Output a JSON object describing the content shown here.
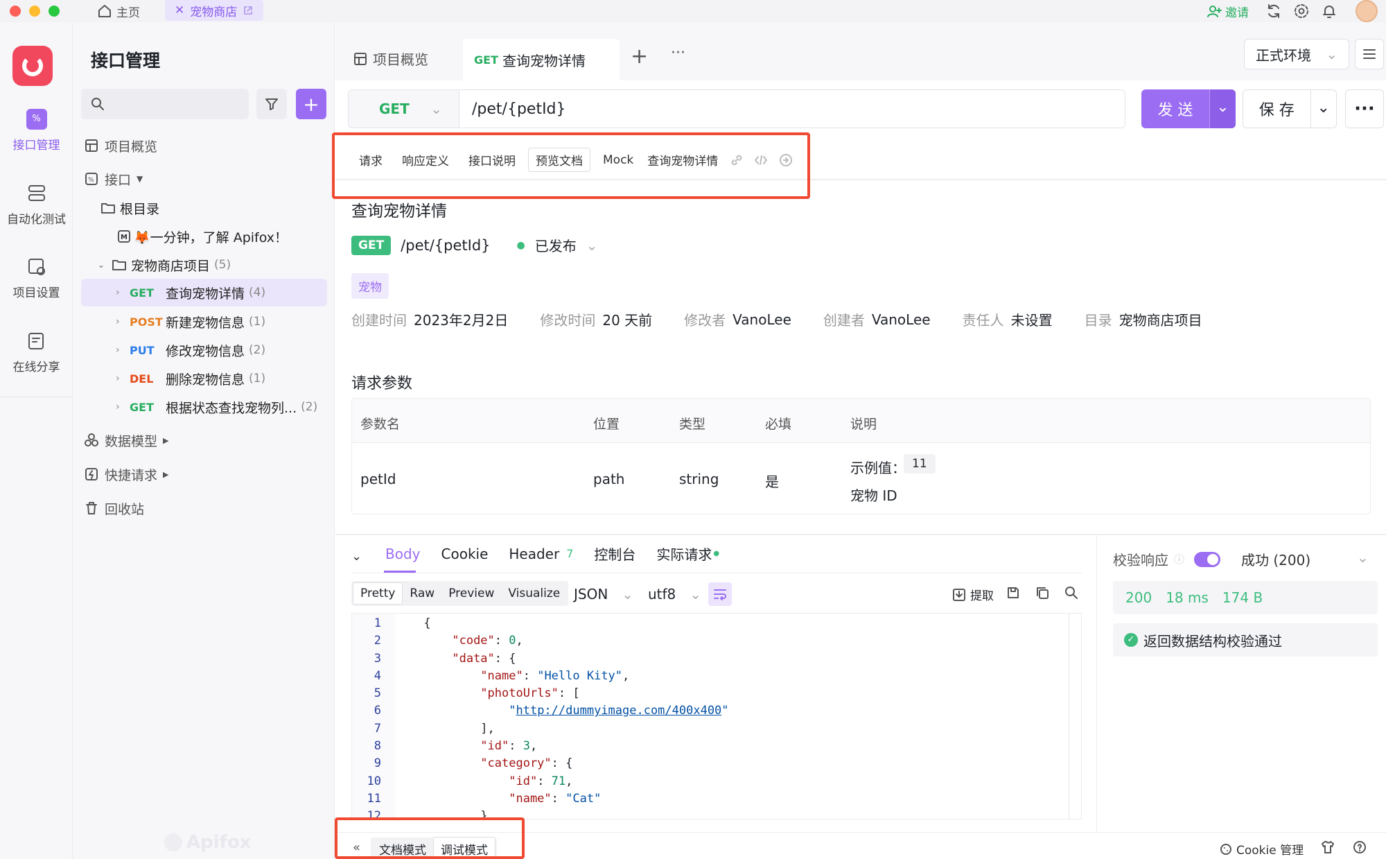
{
  "window_tabs": {
    "home": "主页",
    "active": "宠物商店"
  },
  "topbar": {
    "invite": "邀请"
  },
  "rail": [
    {
      "label": "接口管理"
    },
    {
      "label": "自动化测试"
    },
    {
      "label": "项目设置"
    },
    {
      "label": "在线分享"
    }
  ],
  "sidebar": {
    "title": "接口管理",
    "items": {
      "overview": "项目概览",
      "apis": "接口",
      "root": "根目录",
      "intro": "🦊一分钟，了解 Apifox！",
      "folder": "宠物商店项目",
      "folder_count": "(5)",
      "e1_method": "GET",
      "e1_name": "查询宠物详情",
      "e1_count": "(4)",
      "e2_method": "POST",
      "e2_name": "新建宠物信息",
      "e2_count": "(1)",
      "e3_method": "PUT",
      "e3_name": "修改宠物信息",
      "e3_count": "(2)",
      "e4_method": "DEL",
      "e4_name": "删除宠物信息",
      "e4_count": "(1)",
      "e5_method": "GET",
      "e5_name": "根据状态查找宠物列...",
      "e5_count": "(2)",
      "models": "数据模型",
      "quick": "快捷请求",
      "trash": "回收站"
    }
  },
  "tabs": {
    "overview": "项目概览",
    "active_method": "GET",
    "active_name": "查询宠物详情"
  },
  "env": "正式环境",
  "request": {
    "method": "GET",
    "path": "/pet/{petId}",
    "send": "发 送",
    "save": "保 存"
  },
  "subtabs": [
    "请求",
    "响应定义",
    "接口说明",
    "预览文档",
    "Mock"
  ],
  "subtab_title": "查询宠物详情",
  "doc": {
    "title": "查询宠物详情",
    "method": "GET",
    "path": "/pet/{petId}",
    "status": "已发布",
    "tag": "宠物",
    "meta": [
      {
        "k": "创建时间",
        "v": "2023年2月2日"
      },
      {
        "k": "修改时间",
        "v": "20 天前"
      },
      {
        "k": "修改者",
        "v": "VanoLee"
      },
      {
        "k": "创建者",
        "v": "VanoLee"
      },
      {
        "k": "责任人",
        "v": "未设置"
      },
      {
        "k": "目录",
        "v": "宠物商店项目"
      }
    ],
    "params_title": "请求参数",
    "headers": [
      "参数名",
      "位置",
      "类型",
      "必填",
      "说明"
    ],
    "row": {
      "name": "petId",
      "in": "path",
      "type": "string",
      "required": "是",
      "example_label": "示例值：",
      "example": "11",
      "desc": "宠物 ID"
    }
  },
  "response": {
    "tabs": {
      "body": "Body",
      "cookie": "Cookie",
      "header": "Header",
      "header_count": "7",
      "console": "控制台",
      "actual": "实际请求"
    },
    "views": [
      "Pretty",
      "Raw",
      "Preview",
      "Visualize"
    ],
    "format": "JSON",
    "encoding": "utf8",
    "extract": "提取",
    "lines": [
      "1",
      "2",
      "3",
      "4",
      "5",
      "6",
      "7",
      "8",
      "9",
      "10",
      "11",
      "12"
    ]
  },
  "validation": {
    "label": "校验响应",
    "result": "成功 (200)",
    "code": "200",
    "time": "18 ms",
    "size": "174 B",
    "pass": "返回数据结构校验通过"
  },
  "bottom": {
    "doc_mode": "文档模式",
    "debug_mode": "调试模式",
    "cookie": "Cookie 管理",
    "watermark": "Apifox"
  },
  "colors": {
    "accent": "#9b6df2",
    "get": "#27ae60",
    "post": "#e67e22",
    "put": "#2b7de9",
    "del": "#e64a19",
    "highlight": "#f04a32"
  }
}
